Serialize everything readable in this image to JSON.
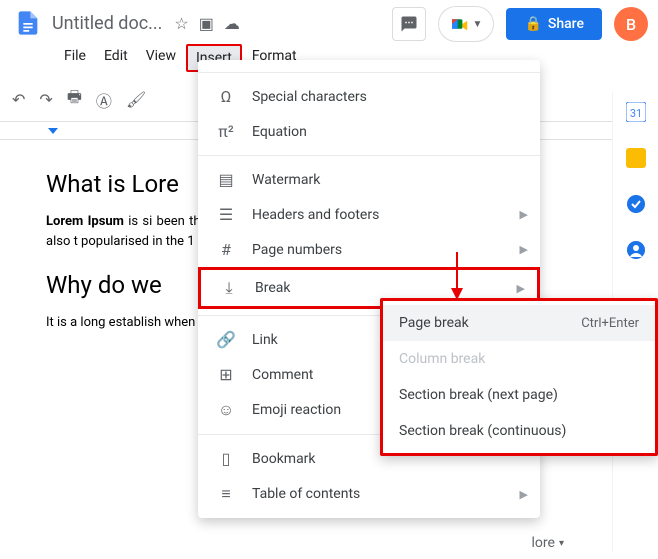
{
  "header": {
    "title": "Untitled doc...",
    "share_label": "Share",
    "avatar_letter": "B"
  },
  "menus": {
    "file": "File",
    "edit": "Edit",
    "view": "View",
    "insert": "Insert",
    "format": "Format"
  },
  "insert_menu": {
    "special_chars": "Special characters",
    "equation": "Equation",
    "watermark": "Watermark",
    "headers_footers": "Headers and footers",
    "page_numbers": "Page numbers",
    "break": "Break",
    "link": "Link",
    "comment": "Comment",
    "emoji": "Emoji reaction",
    "bookmark": "Bookmark",
    "toc": "Table of contents"
  },
  "break_submenu": {
    "page_break": "Page break",
    "page_break_shortcut": "Ctrl+Enter",
    "column_break": "Column break",
    "section_next": "Section break (next page)",
    "section_cont": "Section break (continuous)"
  },
  "document": {
    "h1": "What is Lore",
    "p1_strong": "Lorem Ipsum",
    "p1_rest": " is si been the industry's s galley of type and centuries, but also t popularised in the 1 and more recently w Lorem Ipsum.",
    "h2": "Why do we",
    "p2": "It is a long establish when looking at its distribution of letter"
  },
  "tools_more": "lore"
}
